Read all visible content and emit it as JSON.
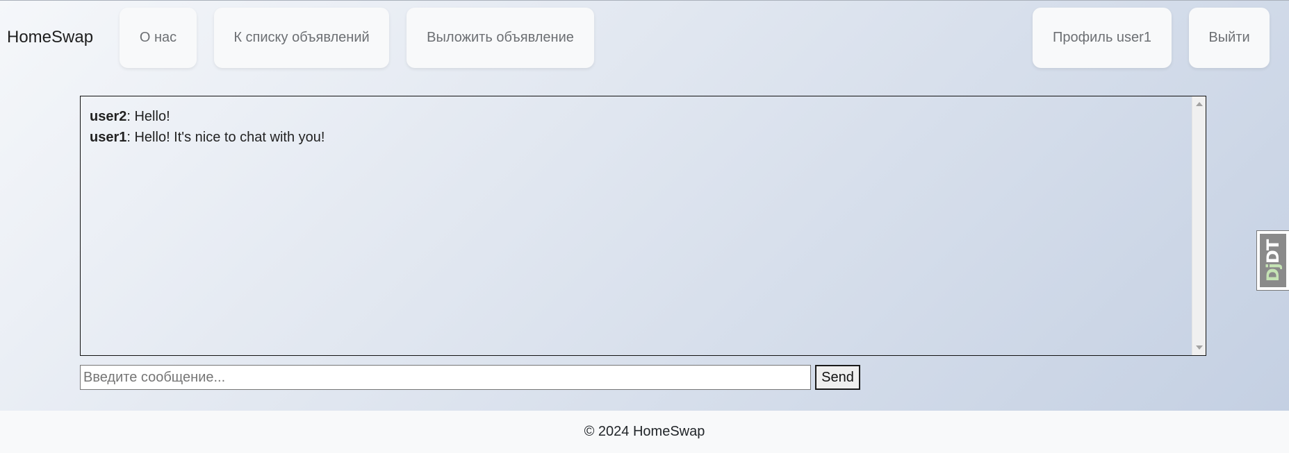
{
  "nav": {
    "brand": "HomeSwap",
    "about": "О нас",
    "listings": "К списку объявлений",
    "post": "Выложить объявление",
    "profile": "Профиль user1",
    "logout": "Выйти"
  },
  "chat": {
    "messages": [
      {
        "user": "user2",
        "text": ": Hello!"
      },
      {
        "user": "user1",
        "text": ": Hello! It's nice to chat with you!"
      }
    ],
    "input_placeholder": "Введите сообщение...",
    "input_value": "",
    "send_label": "Send"
  },
  "debug_toolbar": {
    "label_left": "Dj",
    "label_right": "DT"
  },
  "footer": {
    "text": "© 2024 HomeSwap"
  }
}
